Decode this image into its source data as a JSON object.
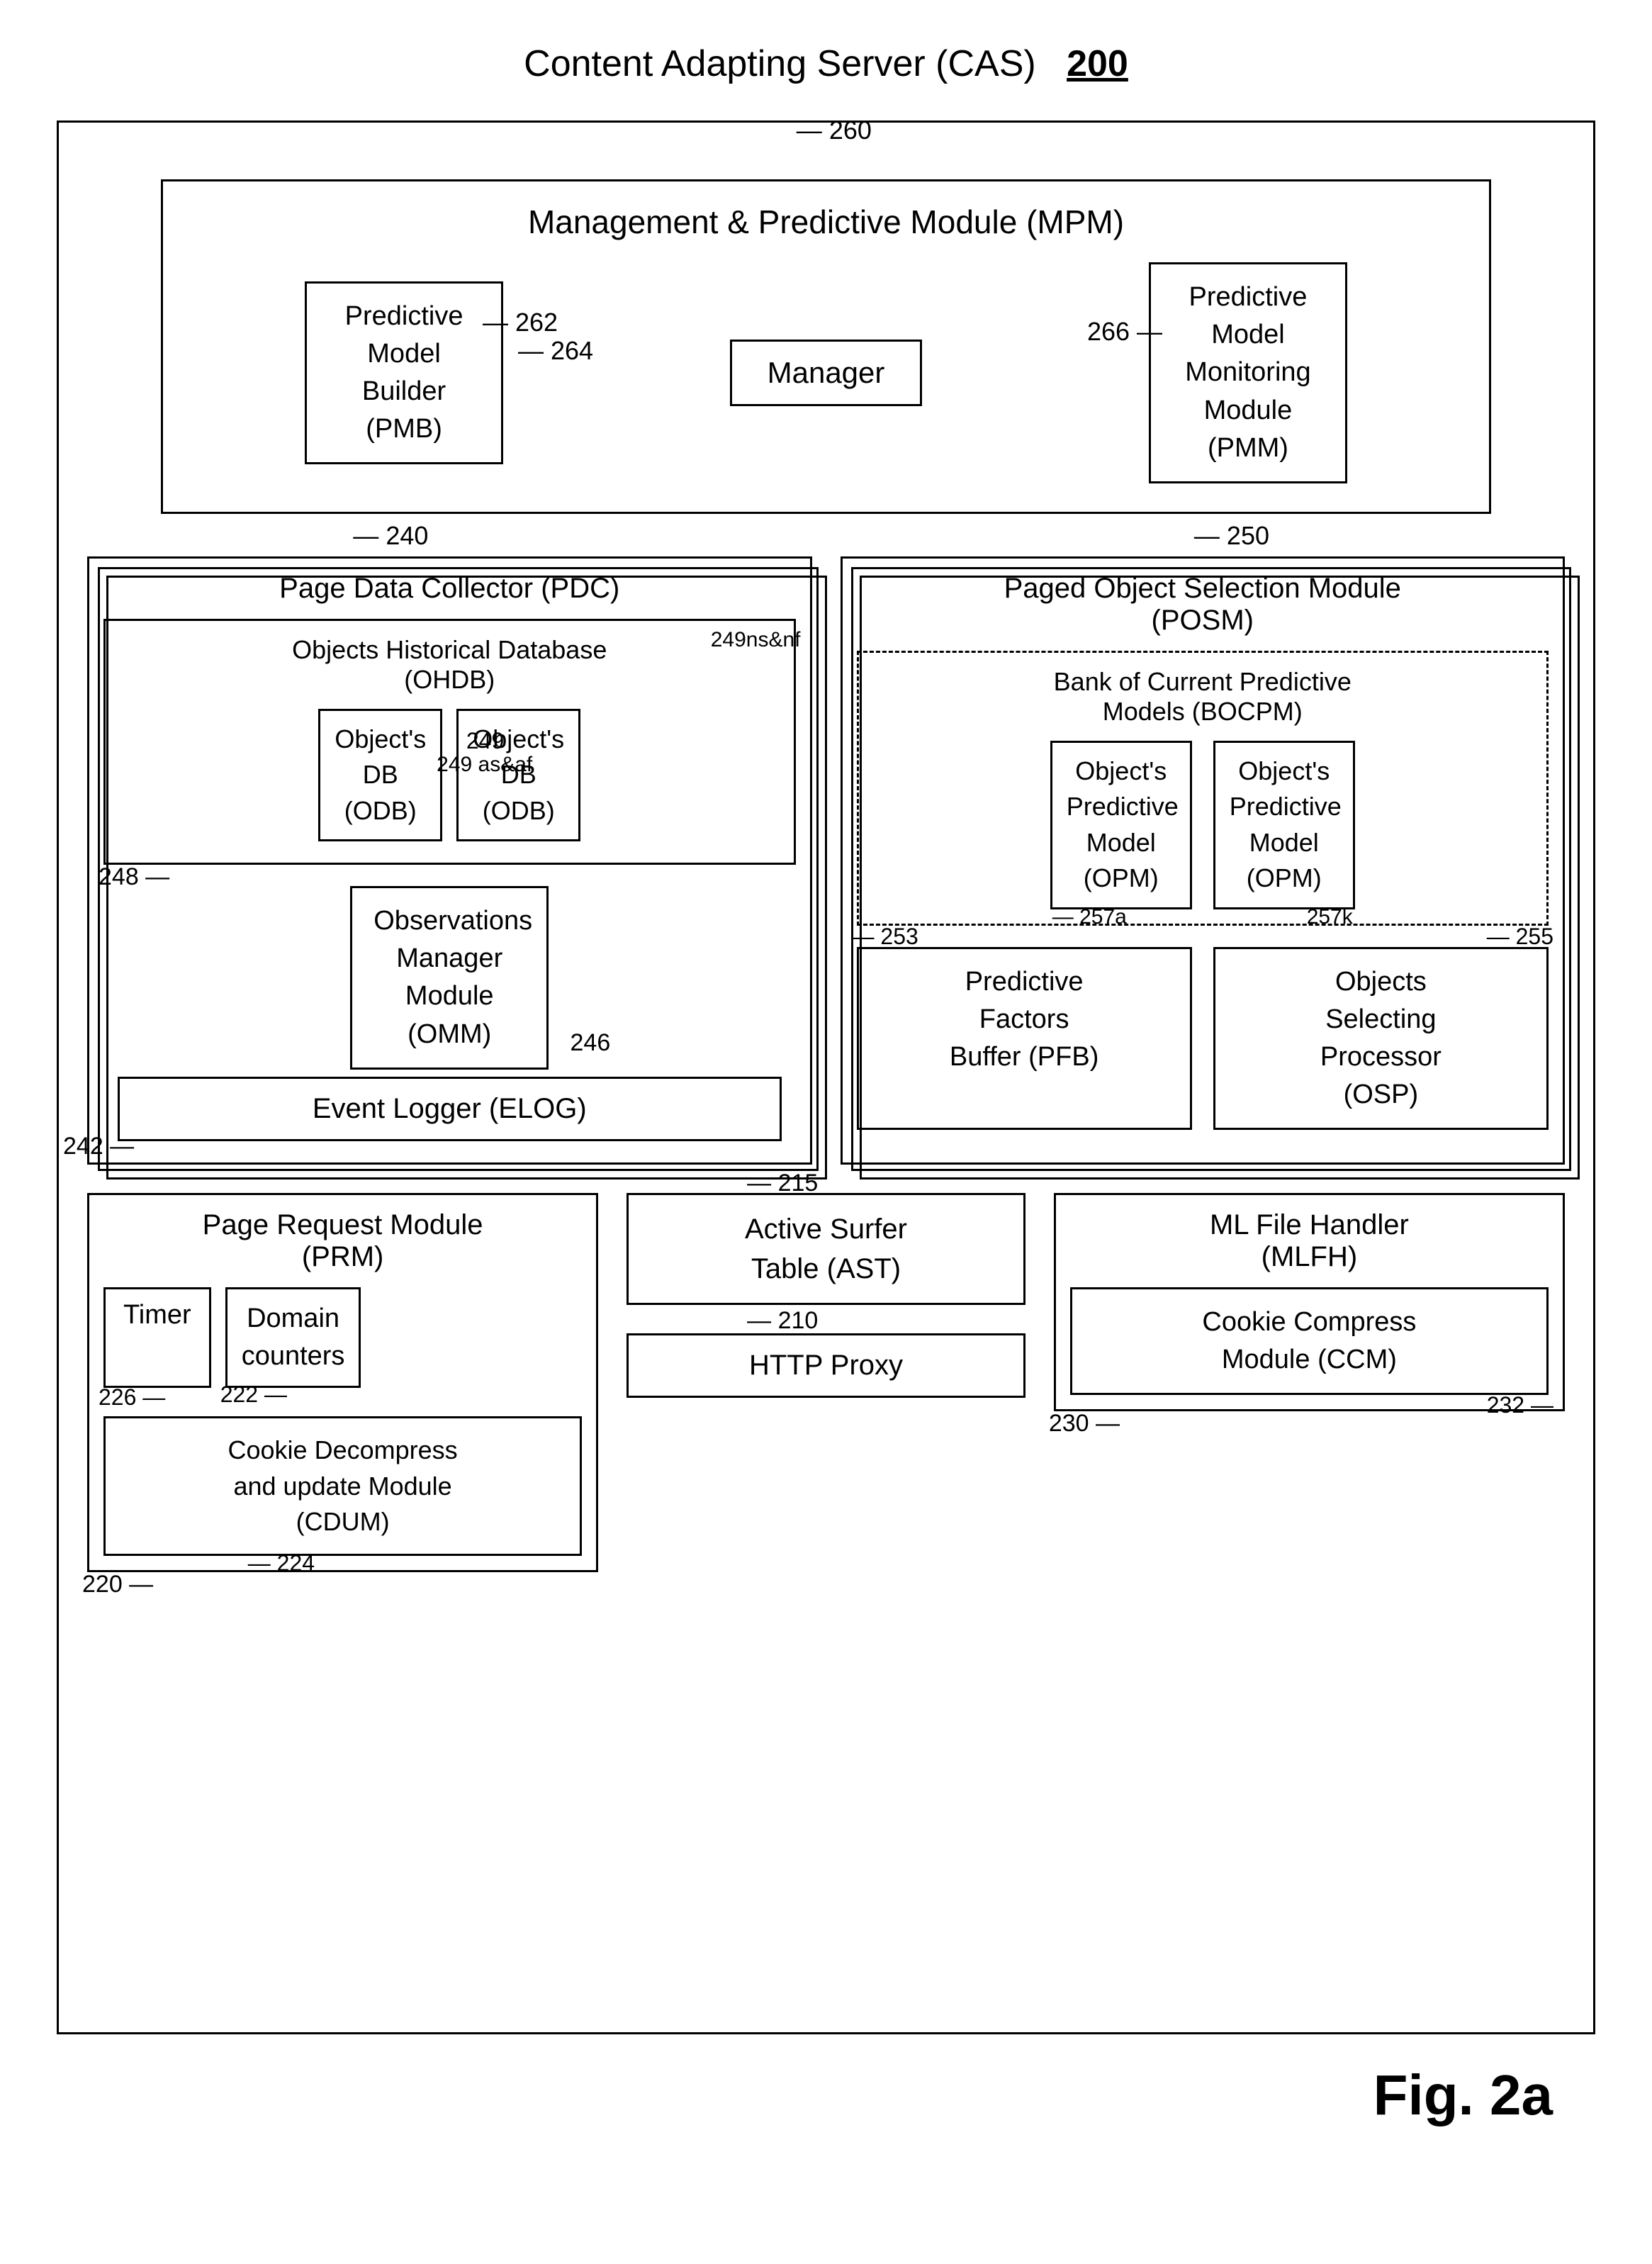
{
  "page": {
    "title": "Content Adapting Server (CAS)",
    "title_ref": "200",
    "fig_label": "Fig. 2a"
  },
  "mpm": {
    "ref": "260",
    "title": "Management & Predictive Module (MPM)",
    "pmb": {
      "label": "Predictive\nModel\nBuilder\n(PMB)",
      "ref": "262"
    },
    "manager": {
      "label": "Manager",
      "ref": "264"
    },
    "pmm": {
      "label": "Predictive\nModel\nMonitoring\nModule\n(PMM)",
      "ref": "266"
    }
  },
  "pdc": {
    "ref": "240",
    "title": "Page Data Collector (PDC)",
    "ohdb": {
      "title": "Objects Historical Database\n(OHDB)",
      "ref_ns": "249ns&nf",
      "odb1": {
        "label": "Object's\nDB\n(ODB)",
        "ref": "249"
      },
      "odb2": {
        "label": "Object's\nDB\n(ODB)",
        "ref": "249 as&af"
      },
      "box_ref": "248"
    },
    "omm": {
      "label": "Observations\nManager\nModule\n(OMM)",
      "ref": "246"
    },
    "elog": {
      "label": "Event Logger (ELOG)",
      "ref": "242"
    }
  },
  "posm": {
    "ref": "250",
    "title": "Paged Object Selection Module\n(POSM)",
    "bocpm": {
      "title": "Bank of Current Predictive\nModels (BOCPM)",
      "opm1": {
        "label": "Object's\nPredictive\nModel\n(OPM)",
        "ref": "257a"
      },
      "opm2": {
        "label": "Object's\nPredictive\nModel\n(OPM)",
        "ref": "257k"
      }
    },
    "pfb": {
      "label": "Predictive\nFactors\nBuffer (PFB)",
      "ref": "253"
    },
    "osp": {
      "label": "Objects\nSelecting\nProcessor\n(OSP)",
      "ref": "255"
    }
  },
  "prm": {
    "ref": "220",
    "title": "Page Request Module\n(PRM)",
    "timer": {
      "label": "Timer",
      "ref": "226"
    },
    "domain": {
      "label": "Domain\ncounters",
      "ref": "222"
    },
    "cdum": {
      "label": "Cookie Decompress\nand update Module\n(CDUM)",
      "ref": "224"
    }
  },
  "ast": {
    "label": "Active Surfer\nTable (AST)",
    "ref": "215"
  },
  "http": {
    "label": "HTTP Proxy",
    "ref": "210"
  },
  "mlfh": {
    "ref": "230",
    "title": "ML File Handler\n(MLFH)",
    "ccm": {
      "label": "Cookie Compress\nModule (CCM)",
      "ref": "232"
    }
  }
}
